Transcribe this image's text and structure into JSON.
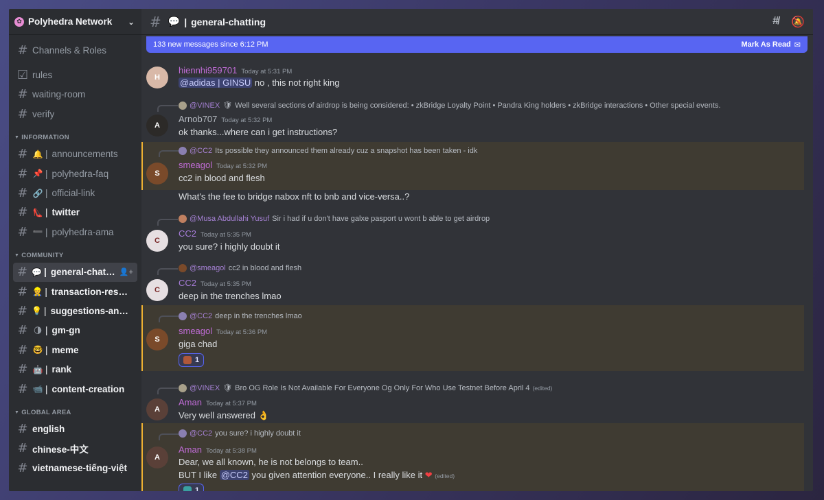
{
  "server": {
    "name": "Polyhedra Network",
    "icon": "polyhedra-logo"
  },
  "sidebar": {
    "top": [
      {
        "label": "Channels & Roles",
        "icon": "channels-roles-icon"
      }
    ],
    "plain": [
      {
        "label": "rules",
        "icon": "rules-icon"
      },
      {
        "label": "waiting-room"
      },
      {
        "label": "verify"
      }
    ],
    "categories": [
      {
        "name": "INFORMATION",
        "channels": [
          {
            "emoji": "🔔",
            "label": "announcements",
            "bold": false
          },
          {
            "emoji": "📌",
            "label": "polyhedra-faq",
            "bold": false
          },
          {
            "emoji": "🔗",
            "label": "official-link",
            "bold": false
          },
          {
            "emoji": "👠",
            "label": "twitter",
            "bold": true
          },
          {
            "emoji": "➖",
            "label": "polyhedra-ama",
            "bold": false
          }
        ]
      },
      {
        "name": "COMMUNITY",
        "channels": [
          {
            "emoji": "💬",
            "label": "general-chatting",
            "bold": true,
            "active": true
          },
          {
            "emoji": "👷",
            "label": "transaction-results",
            "bold": true
          },
          {
            "emoji": "💡",
            "label": "suggestions-and-err...",
            "bold": true
          },
          {
            "emoji": "🌗",
            "label": "gm-gn",
            "bold": true
          },
          {
            "emoji": "🤓",
            "label": "meme",
            "bold": true
          },
          {
            "emoji": "🤖",
            "label": "rank",
            "bold": true
          },
          {
            "emoji": "📹",
            "label": "content-creation",
            "bold": true
          }
        ]
      },
      {
        "name": "GLOBAL AREA",
        "channels": [
          {
            "label": "english",
            "bold": true
          },
          {
            "label": "chinese-中文",
            "bold": true
          },
          {
            "label": "vietnamese-tiếng-việt",
            "bold": true
          }
        ]
      }
    ]
  },
  "header": {
    "channel_emoji": "💬",
    "channel_name": "general-chatting",
    "threads_icon": "threads-icon",
    "notif_icon": "bell-slash-icon"
  },
  "new_messages": {
    "text": "133 new messages since 6:12 PM",
    "action": "Mark As Read"
  },
  "messages": [
    {
      "user": "hiennhi959701",
      "time": "Today at 5:31 PM",
      "mention": "@adidas | GINSU",
      "text": " no , this not right king"
    },
    {
      "reply_user": "@VINEX",
      "reply_text": "Well several sections of airdrop is being considered: • zkBridge Loyalty Point  • Pandra King holders  • zkBridge interactions  • Other special events.",
      "user": "Arnob707",
      "time": "Today at 5:32 PM",
      "text": "ok thanks...where can i get instructions?"
    },
    {
      "reply_user": "@CC2",
      "reply_text": "Its possible they announced them already cuz a snapshot has been taken - idk",
      "user": "smeagol",
      "time": "Today at 5:32 PM",
      "text": "cc2 in blood and flesh",
      "text2": "What's the fee to bridge nabox nft to bnb and vice-versa..?"
    },
    {
      "reply_user": "@Musa Abdullahi Yusuf",
      "reply_text": "Sir i had if u don't have galxe pasport u wont b able to get airdrop",
      "user": "CC2",
      "time": "Today at 5:35 PM",
      "text": "you sure? i highly doubt it"
    },
    {
      "reply_user": "@smeagol",
      "reply_text": "cc2 in blood and flesh",
      "user": "CC2",
      "time": "Today at 5:35 PM",
      "text": "deep in the trenches lmao"
    },
    {
      "reply_user": "@CC2",
      "reply_text": "deep in the trenches lmao",
      "user": "smeagol",
      "time": "Today at 5:36 PM",
      "text": "giga chad",
      "reaction": "1"
    },
    {
      "reply_user": "@VINEX",
      "reply_text": "Bro OG Role Is Not Available For Everyone Og Only For Who Use Testnet Before April 4",
      "reply_edited": "(edited)",
      "user": "Aman",
      "time": "Today at 5:37 PM",
      "text": "Very well answered 👌"
    },
    {
      "reply_user": "@CC2",
      "reply_text": "you sure? i highly doubt it",
      "user": "Aman",
      "time": "Today at 5:38 PM",
      "text": "Dear, we all known, he is not belongs to team..",
      "text2a": "BUT I like ",
      "text2_mention": "@CC2",
      "text2b": " you given attention everyone.. I really like it ",
      "text2_heart": "❤",
      "text2_edited": "(edited)",
      "reaction": "1"
    }
  ],
  "colors": {
    "accent": "#5865f2",
    "highlight": "#f0b232",
    "username": "#c06cd6"
  }
}
